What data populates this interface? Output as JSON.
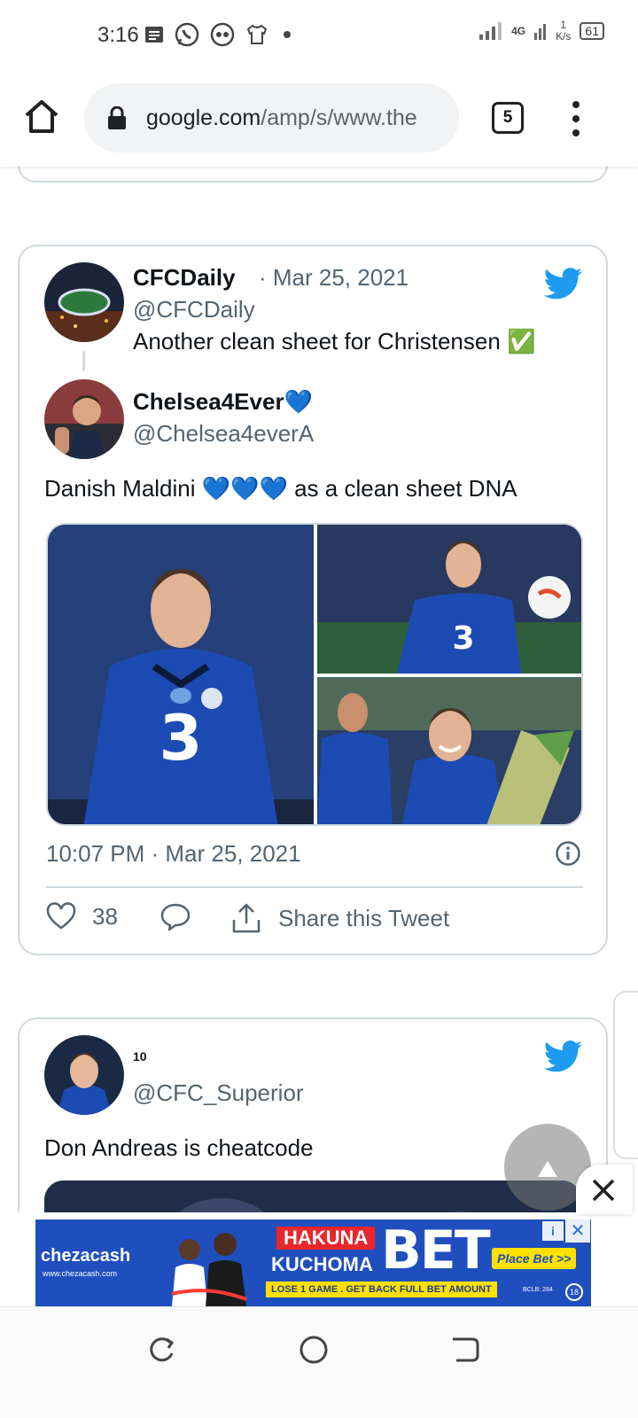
{
  "status_bar": {
    "time": "3:16",
    "network": "4G",
    "speed_value": "1",
    "speed_unit": "K/s",
    "battery": "61",
    "icons": [
      "message-icon",
      "whatsapp-icon",
      "game-icon",
      "shirt-icon",
      "dot-icon",
      "signal-icon",
      "battery-icon"
    ]
  },
  "browser": {
    "url_domain": "google.com",
    "url_rest": "/amp/s/www.the",
    "tab_count": "5"
  },
  "tweet1": {
    "quote_name": "CFCDaily",
    "quote_handle": "@CFCDaily",
    "quote_date": "· Mar 25, 2021",
    "quote_text": "Another clean sheet for Christensen ✅",
    "author_name": "Chelsea4Ever",
    "author_emoji": "💙",
    "author_handle": "@Chelsea4everA",
    "body_text": "Danish Maldini 💙💙💙 as a clean sheet DNA",
    "timestamp": "10:07 PM · Mar 25, 2021",
    "like_count": "38",
    "share_label": "Share this Tweet"
  },
  "tweet2": {
    "author_name": "10",
    "author_handle": "@CFC_Superior",
    "body_text": "Don Andreas is cheatcode"
  },
  "ad": {
    "brand": "chezacash",
    "brand_url": "www.chezacash.com",
    "headline_1": "HAKUNA",
    "headline_2": "KUCHOMA",
    "big_word": "BET",
    "strip": "LOSE 1 GAME . GET BACK FULL BET AMOUNT",
    "cta": "Place Bet >>",
    "license": "BCLB: 284",
    "age": "18"
  },
  "colors": {
    "twitter_blue": "#1d9bf0",
    "chelsea_blue": "#1f4fbf",
    "border": "#cfd9de",
    "secondary_text": "#536471"
  }
}
